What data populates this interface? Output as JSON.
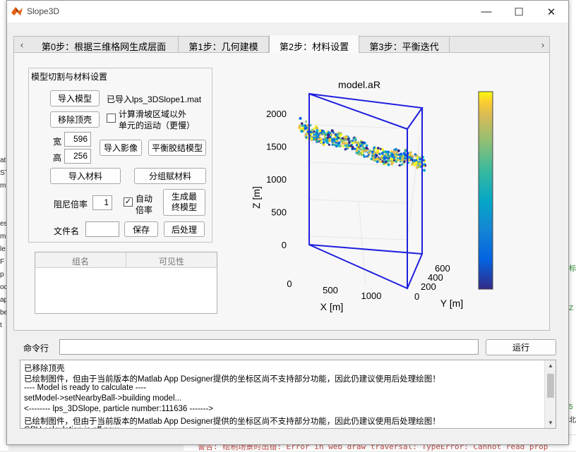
{
  "window": {
    "title": "Slope3D",
    "minimize": "—",
    "maximize": "☐",
    "close": "✕"
  },
  "tabs": [
    {
      "label": "第0步：根据三维格网生成层面"
    },
    {
      "label": "第1步：几何建模"
    },
    {
      "label": "第2步：材料设置",
      "active": true
    },
    {
      "label": "第3步：平衡迭代"
    }
  ],
  "tab_arrows": {
    "left": "‹",
    "right": "›"
  },
  "model_panel": {
    "title": "模型切割与材料设置",
    "import_model": "导入模型",
    "imported_file": "已导入lps_3DSlope1.mat",
    "remove_top": "移除顶壳",
    "compute_outside_label": "计算滑坡区域以外单元的运动（更慢）",
    "compute_outside_line1": "计算滑坡区域以外",
    "compute_outside_line2": "单元的运动（更慢）",
    "compute_outside_checked": false,
    "width_label": "宽",
    "width_value": "596",
    "height_label": "高",
    "height_value": "256",
    "import_image": "导入影像",
    "balance_bond": "平衡胶结模型",
    "import_material": "导入材料",
    "group_material": "分组赋材料",
    "damping_label": "阻尼倍率",
    "damping_value": "1",
    "auto_rate_line1": "自动",
    "auto_rate_line2": "倍率",
    "auto_rate_checked": true,
    "gen_final_line1": "生成最",
    "gen_final_line2": "终模型",
    "filename_label": "文件名",
    "filename_value": "",
    "save": "保存",
    "post_process": "后处理"
  },
  "group_table": {
    "columns": [
      "组名",
      "可见性"
    ],
    "rows": []
  },
  "command": {
    "label": "命令行",
    "value": "",
    "run": "运行"
  },
  "log": {
    "lines": [
      "已移除顶壳",
      "已绘制图件，但由于当前版本的Matlab App Designer提供的坐标区尚不支持部分功能，因此仍建议使用后处理绘图！",
      "---- Model is ready to calculate ----",
      "setModel->setNearbyBall->building model...",
      "<-------- lps_3DSlope, particle number:111636 ------->",
      "已绘制图件，但由于当前版本的Matlab App Designer提供的坐标区尚不支持部分功能，因此仍建议使用后处理绘图！",
      "GPU calculation is off now"
    ]
  },
  "background": {
    "bottom_warning": "警告: 绘制场景时出错: Error in web draw traversal: TypeError: Cannot read prop",
    "left_fragments": [
      "at",
      "ST",
      "m",
      "es",
      "m",
      "le",
      "F",
      "p",
      "oc",
      "ap",
      "be",
      "t"
    ],
    "right_fragments": [
      "标",
      "Z",
      "5",
      "北"
    ]
  },
  "colors": {
    "box_blue": "#1f1fdf",
    "active_tab": "#fafafa",
    "window_bg": "#f0f0f0"
  },
  "chart_data": {
    "type": "scatter",
    "title": "model.aR",
    "xlabel": "X [m]",
    "ylabel": "Y [m]",
    "zlabel": "Z [m]",
    "xlim": [
      0,
      1300
    ],
    "ylim": [
      0,
      600
    ],
    "zlim": [
      0,
      2300
    ],
    "x_ticks": [
      "0",
      "500",
      "1000"
    ],
    "y_ticks": [
      "0",
      "200",
      "400",
      "600"
    ],
    "z_ticks": [
      "0",
      "500",
      "1000",
      "1500",
      "2000"
    ],
    "colormap": "parula",
    "colorbar": true,
    "particle_count": 111636,
    "surface_profile": [
      {
        "x": 0,
        "z_top": 1950,
        "z_bottom": 1750
      },
      {
        "x": 650,
        "z_top": 1580,
        "z_bottom": 1400
      },
      {
        "x": 1300,
        "z_top": 1380,
        "z_bottom": 1180
      }
    ]
  }
}
